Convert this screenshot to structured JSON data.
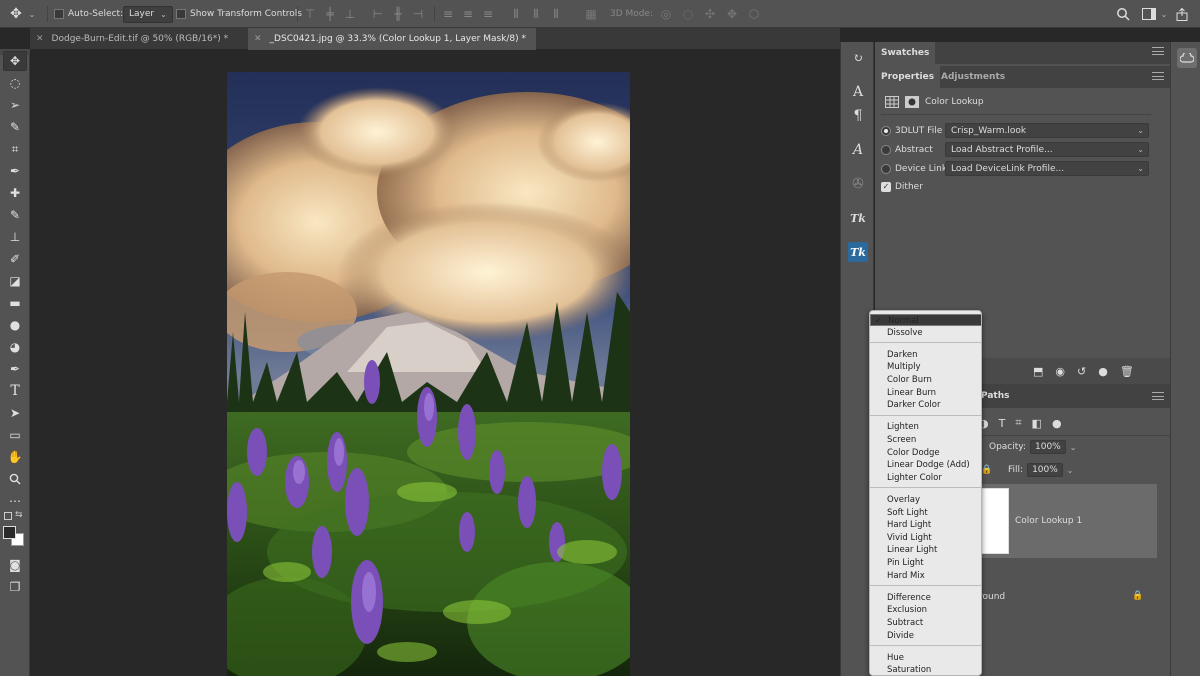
{
  "options_bar": {
    "auto_select_label": "Auto-Select:",
    "auto_select_target": "Layer",
    "transform_label": "Show Transform Controls",
    "mode3d_label": "3D Mode:"
  },
  "tabs": [
    {
      "label": "Dodge-Burn-Edit.tif @ 50% (RGB/16*) *"
    },
    {
      "label": "_DSC0421.jpg @ 33.3% (Color Lookup 1, Layer Mask/8) *"
    }
  ],
  "panels": {
    "swatches_tab": "Swatches",
    "properties_tab": "Properties",
    "adjustments_tab": "Adjustments",
    "adjustment_title": "Color Lookup",
    "lut3d_label": "3DLUT File",
    "lut3d_value": "Crisp_Warm.look",
    "abstract_label": "Abstract",
    "abstract_value": "Load Abstract Profile...",
    "devicelink_label": "Device Link",
    "devicelink_value": "Load DeviceLink Profile...",
    "dither_label": "Dither",
    "paths_tab": "Paths",
    "opacity_label": "Opacity:",
    "opacity_value": "100%",
    "fill_label": "Fill:",
    "fill_value": "100%",
    "layer_name": "Color Lookup 1",
    "background_layer_partial": "round"
  },
  "blend_menu": {
    "selected": "Normal",
    "groups": [
      [
        "Normal",
        "Dissolve"
      ],
      [
        "Darken",
        "Multiply",
        "Color Burn",
        "Linear Burn",
        "Darker Color"
      ],
      [
        "Lighten",
        "Screen",
        "Color Dodge",
        "Linear Dodge (Add)",
        "Lighter Color"
      ],
      [
        "Overlay",
        "Soft Light",
        "Hard Light",
        "Vivid Light",
        "Linear Light",
        "Pin Light",
        "Hard Mix"
      ],
      [
        "Difference",
        "Exclusion",
        "Subtract",
        "Divide"
      ],
      [
        "Hue",
        "Saturation"
      ]
    ]
  },
  "colors": {
    "ui_dark": "#282828",
    "ui_panel": "#535353",
    "menu_bg": "#e9e9e9"
  },
  "icons": {
    "move": "move-tool-icon",
    "search": "search-icon",
    "workspace": "workspace-icon",
    "cc": "creative-cloud-icon"
  }
}
